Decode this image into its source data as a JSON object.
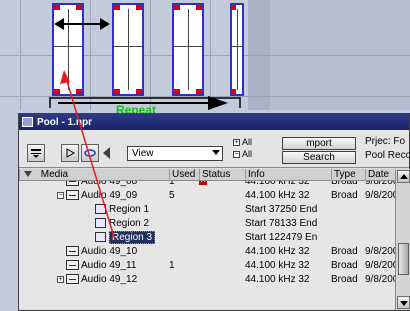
{
  "arrange": {
    "repeat_label": "Repeat"
  },
  "pool": {
    "title": "Pool - 1.npr",
    "toolbar": {
      "view_value": "View",
      "all_label_1": "All",
      "all_label_2": "All",
      "import_label": "mport",
      "search_label": "Search",
      "project_folder_label": "Prjec: Fo",
      "pool_record_label": "Pool Reco"
    },
    "columns": [
      "Media",
      "Used",
      "Status",
      "Info",
      "Type",
      "Date"
    ],
    "rows": [
      {
        "kind": "clip",
        "indent": 1,
        "expander": "",
        "name": "Audio 49_08",
        "used": "1",
        "status": "rec",
        "info": "44.100 kHz  32",
        "type": "Broad",
        "date": "9/8/200"
      },
      {
        "kind": "clip",
        "indent": 1,
        "expander": "−",
        "name": "Audio 49_09",
        "used": "5",
        "status": "",
        "info": "44.100 kHz  32",
        "type": "Broad",
        "date": "9/8/200"
      },
      {
        "kind": "region",
        "indent": 2,
        "name": "Region 1",
        "used": "",
        "status": "",
        "info": "Start 37250  End",
        "type": "",
        "date": ""
      },
      {
        "kind": "region",
        "indent": 2,
        "name": "Region 2",
        "used": "",
        "status": "",
        "info": "Start 78133  End",
        "type": "",
        "date": ""
      },
      {
        "kind": "region",
        "indent": 2,
        "name": "Region 3",
        "selected": true,
        "used": "",
        "status": "",
        "info": "Start 122479  En",
        "type": "",
        "date": ""
      },
      {
        "kind": "clip",
        "indent": 1,
        "expander": "",
        "name": "Audio 49_10",
        "used": "",
        "status": "",
        "info": "44.100 kHz  32",
        "type": "Broad",
        "date": "9/8/200"
      },
      {
        "kind": "clip",
        "indent": 1,
        "expander": "",
        "name": "Audio 49_11",
        "used": "1",
        "status": "",
        "info": "44.100 kHz  32",
        "type": "Broad",
        "date": "9/8/200"
      },
      {
        "kind": "clip",
        "indent": 1,
        "expander": "+",
        "name": "Audio 49_12",
        "used": "",
        "status": "",
        "info": "44.100 kHz  32",
        "type": "Broad",
        "date": "9/8/200"
      }
    ]
  },
  "colors": {
    "accent_green": "#10c010",
    "arrow_red": "#e02020",
    "selection": "#20305a"
  }
}
